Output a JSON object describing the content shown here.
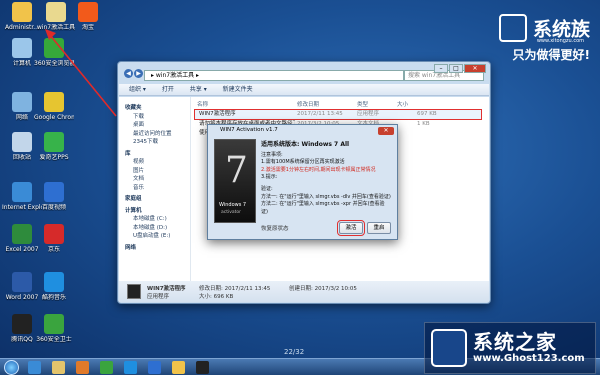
{
  "desktop": {
    "icons": [
      {
        "label": "Administr...",
        "color": "#f1c34a"
      },
      {
        "label": "win7激活工具",
        "color": "#e9d98f"
      },
      {
        "label": "淘宝",
        "color": "#f25a1b"
      },
      {
        "label": "计算机",
        "color": "#9bc6ea"
      },
      {
        "label": "360安全浏览器",
        "color": "#36a83a"
      },
      {
        "label": "网络",
        "color": "#7fb3e0"
      },
      {
        "label": "Google Chrome",
        "color": "#e6c530"
      },
      {
        "label": "回收站",
        "color": "#c2d6ea"
      },
      {
        "label": "爱奇艺PPS",
        "color": "#37b34a"
      },
      {
        "label": "Internet Explorer",
        "color": "#3a8bd6"
      },
      {
        "label": "百度视频",
        "color": "#2e6fd1"
      },
      {
        "label": "Excel 2007",
        "color": "#2e8b3c"
      },
      {
        "label": "京东",
        "color": "#d62a2a"
      },
      {
        "label": "Word 2007",
        "color": "#2c5aa8"
      },
      {
        "label": "酷狗音乐",
        "color": "#1f8fe0"
      },
      {
        "label": "腾讯QQ",
        "color": "#222222"
      },
      {
        "label": "360安全卫士",
        "color": "#3aa43e"
      }
    ],
    "page_indicator": "22/32"
  },
  "brand": {
    "name": "系统族",
    "url": "www.xitongzu.com",
    "slogan": "只为做得更好!"
  },
  "explorer": {
    "address": "▸ win7激活工具 ▸",
    "search_placeholder": "搜索 win7激活工具",
    "toolbar": [
      "组织 ▾",
      "打开",
      "共享 ▾",
      "新建文件夹"
    ],
    "nav": [
      {
        "label": "收藏夹",
        "group": true
      },
      {
        "label": "下载"
      },
      {
        "label": "桌面"
      },
      {
        "label": "最近访问的位置"
      },
      {
        "label": "2345下载"
      },
      {
        "label": "库",
        "group": true
      },
      {
        "label": "视频"
      },
      {
        "label": "图片"
      },
      {
        "label": "文档"
      },
      {
        "label": "音乐"
      },
      {
        "label": "家庭组",
        "group": true
      },
      {
        "label": "计算机",
        "group": true
      },
      {
        "label": "本地磁盘 (C:)"
      },
      {
        "label": "本地磁盘 (D:)"
      },
      {
        "label": "U盘启动盘 (E:)"
      },
      {
        "label": "网络",
        "group": true
      }
    ],
    "columns": {
      "name": "名称",
      "date": "修改日期",
      "type": "类型",
      "size": "大小"
    },
    "files": [
      {
        "name": "WIN7激活程序",
        "date": "2017/2/11 13:45",
        "type": "应用程序",
        "size": "697 KB"
      },
      {
        "name": "请勿将本程序存放在桌面或者中文路径下使用",
        "date": "2017/3/2 10:05",
        "type": "文本文档",
        "size": "1 KB"
      },
      {
        "name": "使用说明",
        "date": "",
        "type": "",
        "size": ""
      }
    ],
    "status": {
      "name": "WIN7激活程序",
      "date": "修改日期: 2017/2/11 13:45",
      "created": "创建日期: 2017/3/2 10:05",
      "type": "应用程序",
      "size": "大小: 696 KB"
    }
  },
  "dialog": {
    "title": "WIN7 Activation v1.7",
    "splash_numeral": "7",
    "splash_title": "Windows 7",
    "splash_sub": "activator",
    "version_line": "适用系统版本: Windows 7 All",
    "notice_title": "注意事项:",
    "notes": [
      "1.需有100M系统保留分区再实现激活",
      "2.激活需要1分钟左右时间,期间出现卡顿属正常情况",
      "3.提示:"
    ],
    "verify_title": "验证:",
    "verify": [
      "方法一: 在\"运行\"里输入 slmgr.vbs -dlv 并回车(查看验证)",
      "方法二: 在\"运行\"里输入 slmgr.vbs -xpr 并回车(查看验证)"
    ],
    "footer": "恢复原状态",
    "activate_label": "激活",
    "restart_label": "重启"
  },
  "taskbar": {
    "icons": [
      {
        "name": "ie",
        "color": "#3a8bd6"
      },
      {
        "name": "explorer",
        "color": "#e3c46c"
      },
      {
        "name": "media",
        "color": "#e07a2a"
      },
      {
        "name": "360",
        "color": "#3aa43e"
      },
      {
        "name": "kugou",
        "color": "#1f8fe0"
      },
      {
        "name": "baidu",
        "color": "#2e6fd1"
      },
      {
        "name": "folder",
        "color": "#f1c34a"
      },
      {
        "name": "activator",
        "color": "#222222"
      }
    ]
  },
  "watermark": {
    "title": "系统之家",
    "url": "www.Ghost123.com"
  }
}
